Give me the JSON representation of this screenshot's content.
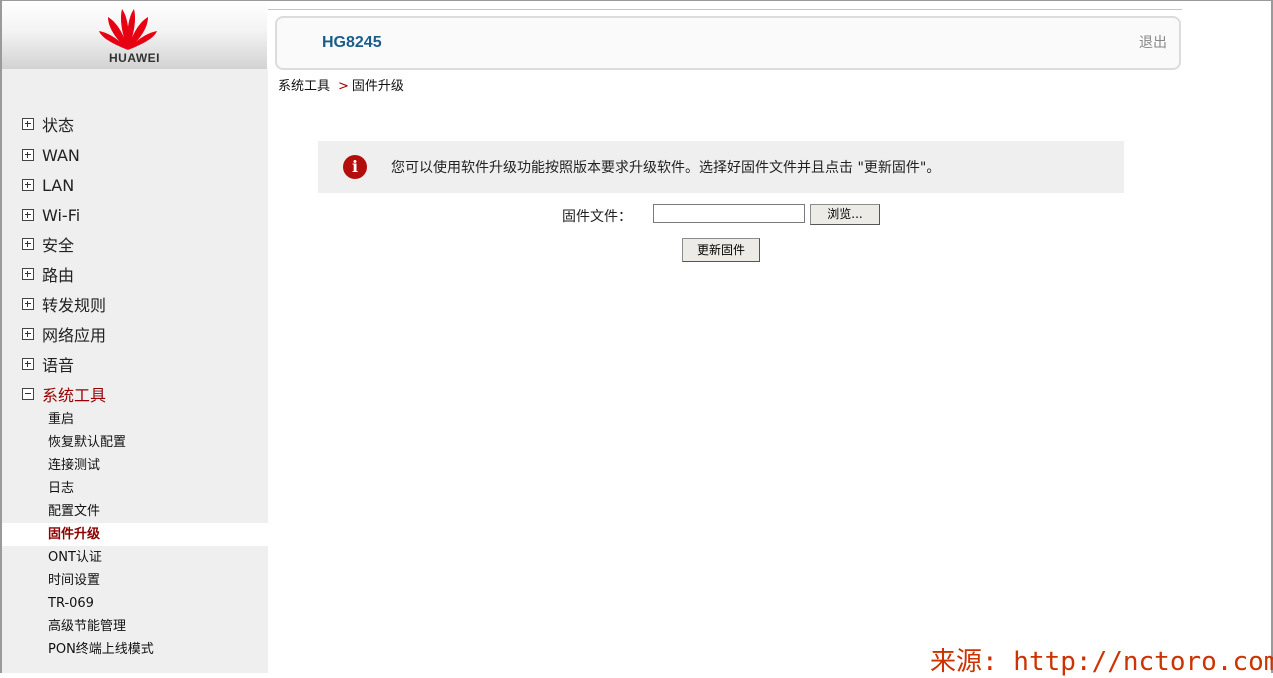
{
  "brand": {
    "logo_text": "HUAWEI",
    "logo_color": "#e60012"
  },
  "header": {
    "model": "HG8245",
    "logout_label": "退出"
  },
  "breadcrumb": {
    "parent": "系统工具",
    "separator": ">",
    "current": "固件升级"
  },
  "nav": {
    "items": [
      {
        "label": "状态",
        "expanded": false
      },
      {
        "label": "WAN",
        "expanded": false
      },
      {
        "label": "LAN",
        "expanded": false
      },
      {
        "label": "Wi-Fi",
        "expanded": false
      },
      {
        "label": "安全",
        "expanded": false
      },
      {
        "label": "路由",
        "expanded": false
      },
      {
        "label": "转发规则",
        "expanded": false
      },
      {
        "label": "网络应用",
        "expanded": false
      },
      {
        "label": "语音",
        "expanded": false
      },
      {
        "label": "系统工具",
        "expanded": true
      }
    ],
    "sub_items": [
      {
        "label": "重启"
      },
      {
        "label": "恢复默认配置"
      },
      {
        "label": "连接测试"
      },
      {
        "label": "日志"
      },
      {
        "label": "配置文件"
      },
      {
        "label": "固件升级",
        "active": true
      },
      {
        "label": "ONT认证"
      },
      {
        "label": "时间设置"
      },
      {
        "label": "TR-069"
      },
      {
        "label": "高级节能管理"
      },
      {
        "label": "PON终端上线模式"
      }
    ]
  },
  "info": {
    "icon": "info-icon",
    "text": "您可以使用软件升级功能按照版本要求升级软件。选择好固件文件并且点击 \"更新固件\"。"
  },
  "form": {
    "file_label": "固件文件：",
    "file_value": "",
    "browse_label": "浏览...",
    "update_label": "更新固件"
  },
  "watermark": "来源: http://nctoro.com",
  "colors": {
    "accent_red": "#990000",
    "model_blue": "#1a5d8a",
    "sidebar_bg": "#efefef"
  }
}
